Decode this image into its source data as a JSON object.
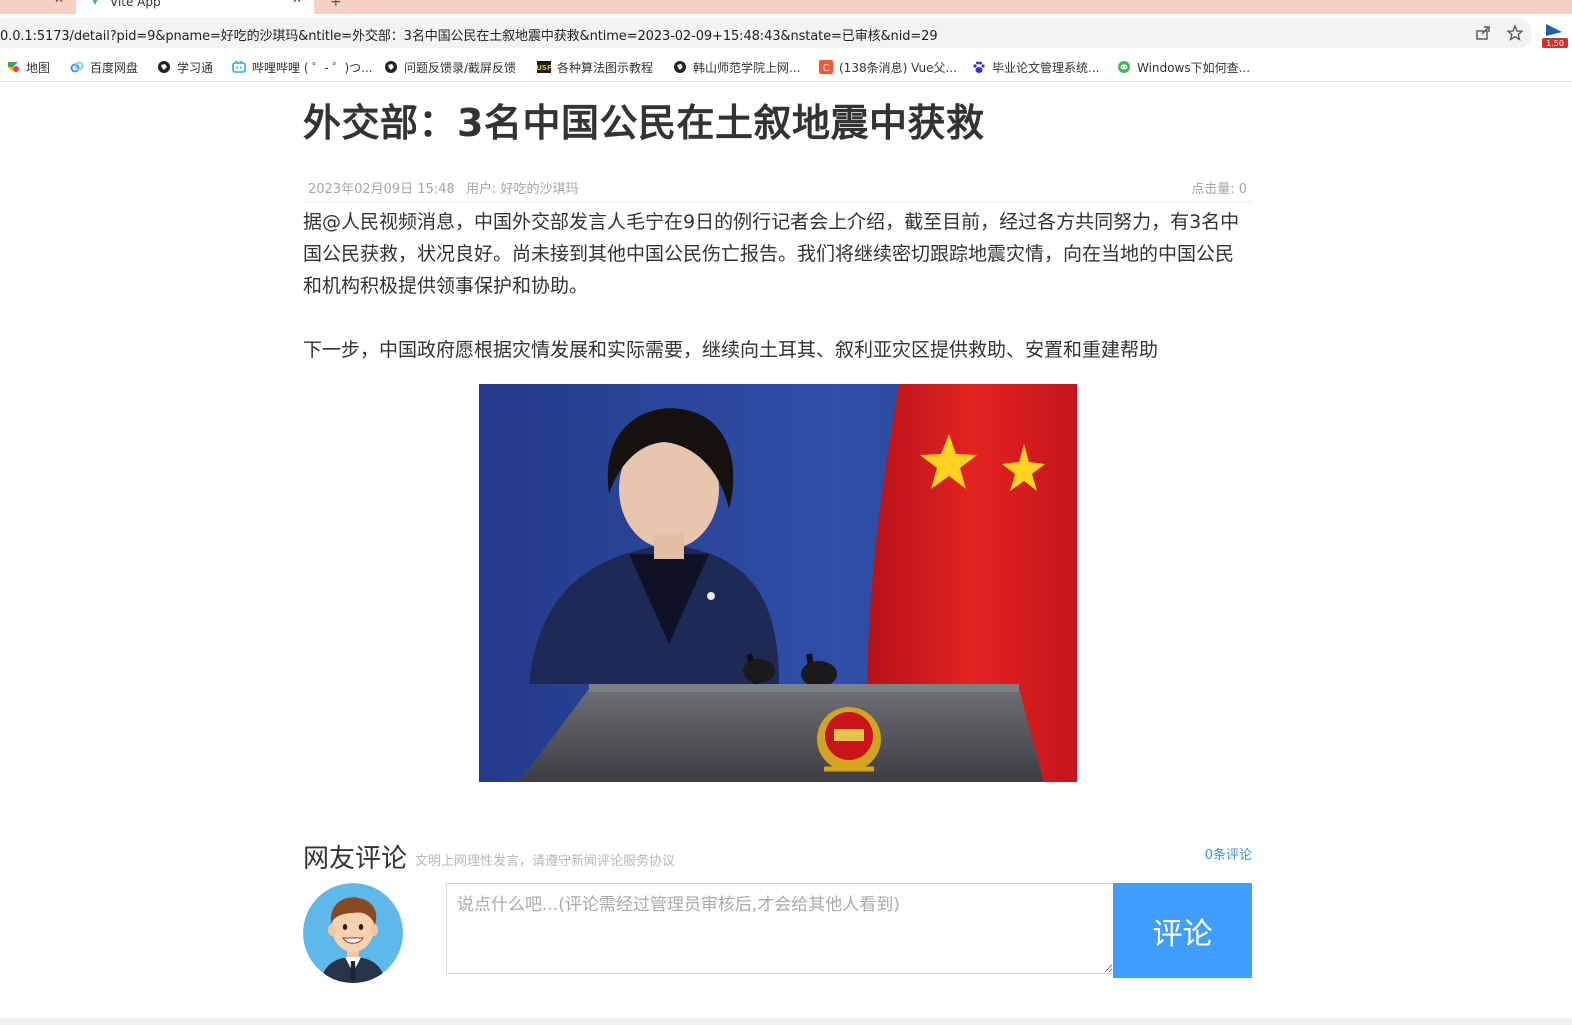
{
  "browser": {
    "tabs": [
      {
        "label": ""
      },
      {
        "label": "Vite App"
      }
    ],
    "url": "0.0.1:5173/detail?pid=9&pname=好吃的沙琪玛&ntitle=外交部：3名中国公民在土叙地震中获救&ntime=2023-02-09+15:48:43&nstate=已审核&nid=29",
    "extension_badge": "1.50",
    "bookmarks": [
      {
        "label": "地图",
        "icon": "maps-icon"
      },
      {
        "label": "百度网盘",
        "icon": "baidu-netdisk-icon"
      },
      {
        "label": "学习通",
        "icon": "globe-icon"
      },
      {
        "label": "哔哩哔哩 ( ゜- ゜)つ...",
        "icon": "bilibili-icon"
      },
      {
        "label": "问题反馈录/截屏反馈",
        "icon": "globe-icon"
      },
      {
        "label": "各种算法图示教程",
        "icon": "usf-icon"
      },
      {
        "label": "韩山师范学院上网...",
        "icon": "globe-icon"
      },
      {
        "label": "(138条消息) Vue父...",
        "icon": "csdn-icon"
      },
      {
        "label": "毕业论文管理系统...",
        "icon": "baidu-paw-icon"
      },
      {
        "label": "Windows下如何查...",
        "icon": "chat-bubble-icon"
      }
    ]
  },
  "article": {
    "title": "外交部：3名中国公民在土叙地震中获救",
    "date": "2023年02月09日  15:48",
    "user": "用户: 好吃的沙琪玛",
    "clicks": "点击量:   0",
    "paragraphs": [
      "据@人民视频消息，中国外交部发言人毛宁在9日的例行记者会上介绍，截至目前，经过各方共同努力，有3名中国公民获救，状况良好。尚未接到其他中国公民伤亡报告。我们将继续密切跟踪地震灾情，向在当地的中国公民和机构积极提供领事保护和协助。",
      "下一步，中国政府愿根据灾情发展和实际需要，继续向土耳其、叙利亚灾区提供救助、安置和重建帮助"
    ]
  },
  "comments": {
    "title": "网友评论",
    "tip": "文明上网理性发言，请遵守新闻评论服务协议",
    "count": "0条评论",
    "placeholder": "说点什么吧...(评论需经过管理员审核后,才会给其他人看到)",
    "submit_label": "评论"
  },
  "colors": {
    "tab_strip": "#f6d2c4",
    "primary_button": "#409efe",
    "link": "#3c8fe6"
  }
}
